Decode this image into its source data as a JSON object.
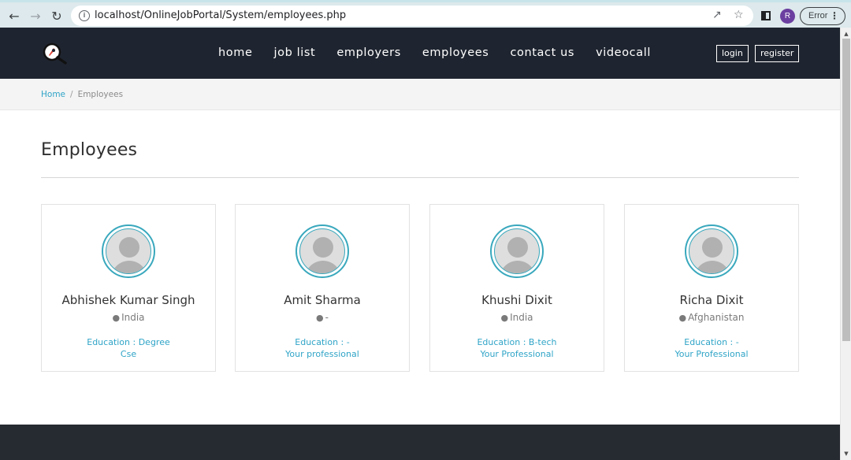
{
  "browser": {
    "url": "localhost/OnlineJobPortal/System/employees.php",
    "profile_initial": "R",
    "status_label": "Error"
  },
  "navbar": {
    "links": [
      "home",
      "job list",
      "employers",
      "employees",
      "contact us",
      "videocall"
    ],
    "login_label": "login",
    "register_label": "register"
  },
  "breadcrumb": {
    "home": "Home",
    "separator": "/",
    "current": "Employees"
  },
  "page": {
    "title": "Employees"
  },
  "employees": [
    {
      "name": "Abhishek Kumar Singh",
      "location": "India",
      "education_line1": "Education : Degree",
      "education_line2": "Cse"
    },
    {
      "name": "Amit Sharma",
      "location": "-",
      "education_line1": "Education : -",
      "education_line2": "Your professional"
    },
    {
      "name": "Khushi Dixit",
      "location": "India",
      "education_line1": "Education : B-tech",
      "education_line2": "Your Professional"
    },
    {
      "name": "Richa Dixit",
      "location": "Afghanistan",
      "education_line1": "Education : -",
      "education_line2": "Your Professional"
    }
  ],
  "colors": {
    "accent": "#2fa4c7",
    "navbar_bg": "#1f2530",
    "footer_bg": "#262a31",
    "avatar_ring": "#39a8bd"
  }
}
